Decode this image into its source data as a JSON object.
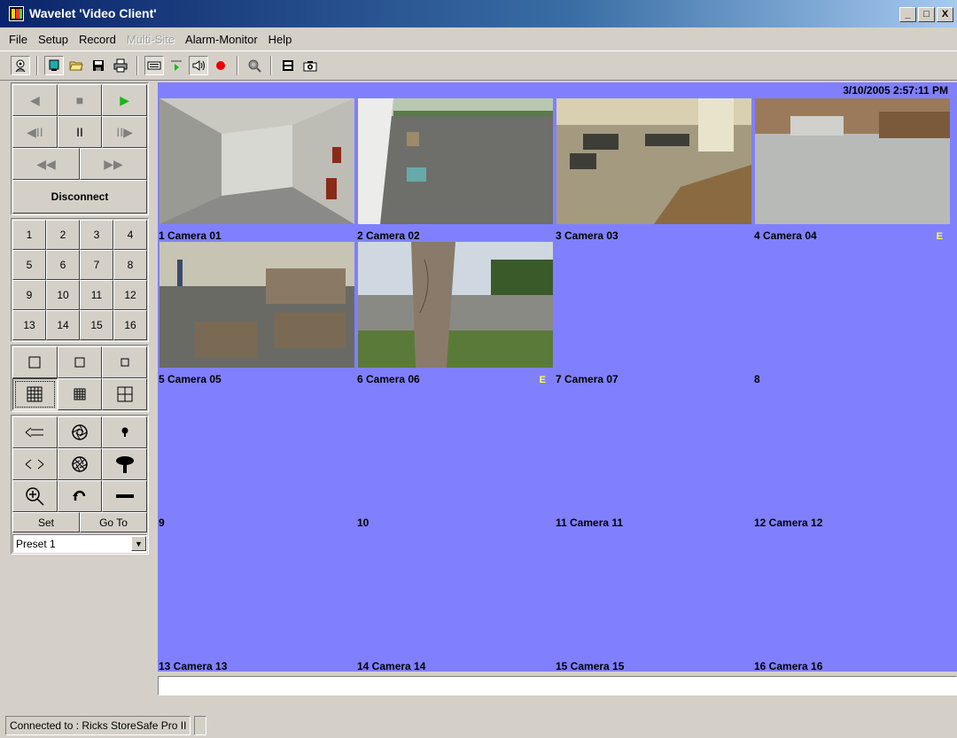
{
  "window": {
    "title": "Wavelet 'Video Client'",
    "min": "_",
    "max": "□",
    "close": "X"
  },
  "menu": [
    {
      "label": "File",
      "enabled": true
    },
    {
      "label": "Setup",
      "enabled": true
    },
    {
      "label": "Record",
      "enabled": true
    },
    {
      "label": "Multi-Site",
      "enabled": false
    },
    {
      "label": "Alarm-Monitor",
      "enabled": true
    },
    {
      "label": "Help",
      "enabled": true
    }
  ],
  "toolbar": [
    "connect-icon",
    "monitor-icon",
    "open-folder-icon",
    "save-icon",
    "print-icon",
    "playback-icon",
    "live-icon",
    "audio-icon",
    "record-icon",
    "search-icon",
    "film-icon",
    "snapshot-icon"
  ],
  "playback": {
    "prev": "◀",
    "stop": "■",
    "play": "▶",
    "step_back": "◀II",
    "pause": "II",
    "step_fwd": "II▶",
    "rewind": "◀◀",
    "ffwd": "▶▶",
    "disconnect": "Disconnect"
  },
  "camera_numbers": [
    "1",
    "2",
    "3",
    "4",
    "5",
    "6",
    "7",
    "8",
    "9",
    "10",
    "11",
    "12",
    "13",
    "14",
    "15",
    "16"
  ],
  "ptz": {
    "set": "Set",
    "goto": "Go To",
    "preset": "Preset 1",
    "dropdown": "▼"
  },
  "datetime": "3/10/2005 2:57:11 PM",
  "cells": [
    {
      "label": "1 Camera 01",
      "e": ""
    },
    {
      "label": "2 Camera 02",
      "e": ""
    },
    {
      "label": "3 Camera 03",
      "e": ""
    },
    {
      "label": "4 Camera 04",
      "e": "E"
    },
    {
      "label": "5 Camera 05",
      "e": ""
    },
    {
      "label": "6 Camera 06",
      "e": "E"
    },
    {
      "label": "7 Camera 07",
      "e": ""
    },
    {
      "label": "8",
      "e": ""
    },
    {
      "label": "9",
      "e": ""
    },
    {
      "label": "10",
      "e": ""
    },
    {
      "label": "11 Camera 11",
      "e": ""
    },
    {
      "label": "12 Camera 12",
      "e": ""
    },
    {
      "label": "13 Camera 13",
      "e": ""
    },
    {
      "label": "14 Camera 14",
      "e": ""
    },
    {
      "label": "15 Camera 15",
      "e": ""
    },
    {
      "label": "16 Camera 16",
      "e": ""
    }
  ],
  "status": {
    "connection": "Connected to : Ricks StoreSafe Pro II",
    "extra": ""
  }
}
